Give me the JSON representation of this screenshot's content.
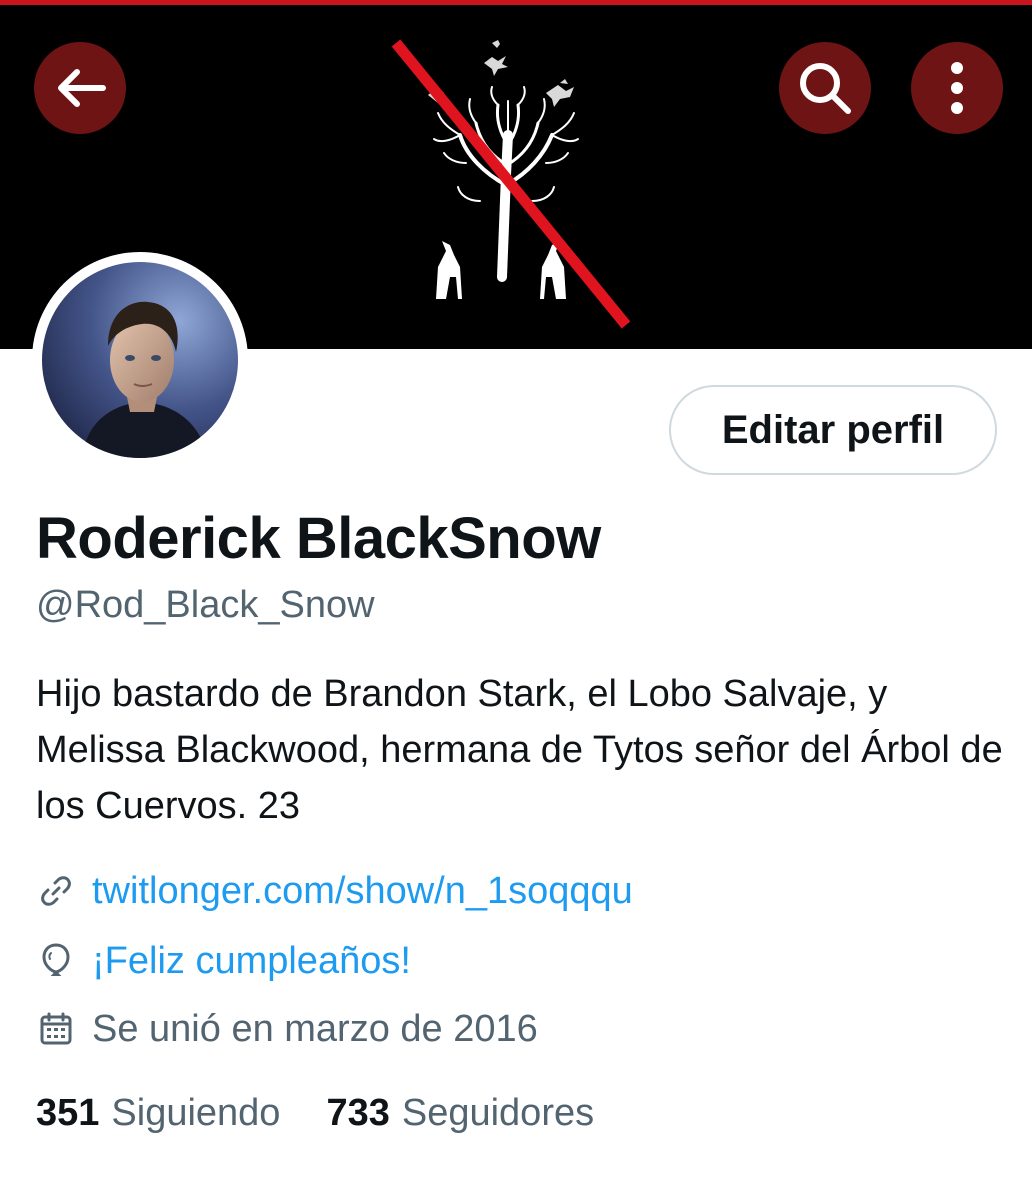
{
  "header": {
    "back_icon": "arrow-left-icon",
    "search_icon": "search-icon",
    "more_icon": "more-vertical-icon",
    "button_color": "#6e1414",
    "accent_color": "#c8151d"
  },
  "profile": {
    "edit_button_label": "Editar perfil",
    "display_name": "Roderick BlackSnow",
    "handle": "@Rod_Black_Snow",
    "bio": "Hijo bastardo de Brandon Stark, el Lobo Salvaje, y Melissa Blackwood, hermana de Tytos señor del Árbol de los Cuervos. 23",
    "link": "twitlonger.com/show/n_1soqqqu",
    "birthday": "¡Feliz cumpleaños!",
    "joined": "Se unió en marzo de 2016",
    "following_count": "351",
    "following_label": "Siguiendo",
    "followers_count": "733",
    "followers_label": "Seguidores"
  }
}
